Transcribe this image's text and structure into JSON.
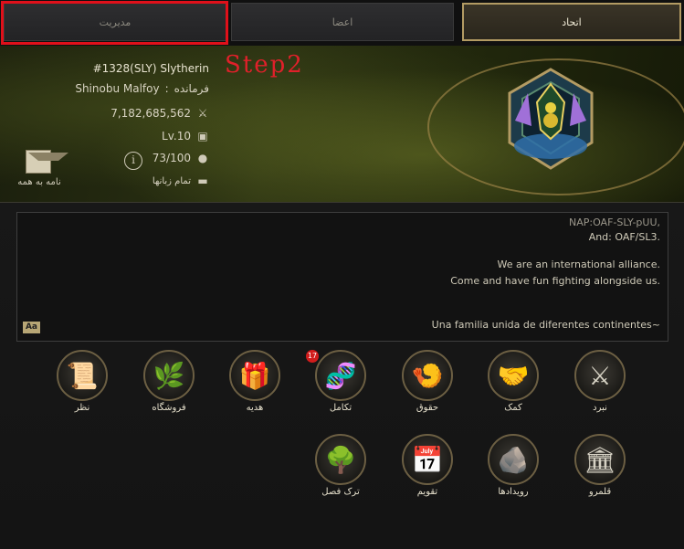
{
  "tabs": [
    {
      "label": "مدیریت"
    },
    {
      "label": "اعضا"
    },
    {
      "label": "اتحاد"
    }
  ],
  "annotation": {
    "step_label": "Step2",
    "highlight_color": "#e0101a"
  },
  "alliance": {
    "rank_name": "#1328(SLY) Slytherin",
    "leader_name": "Shinobu Malfoy",
    "leader_role": "فرمانده",
    "power": "7,182,685,562",
    "level": "Lv.10",
    "members": "73/100",
    "language": "تمام زبانها",
    "mail_label": "نامه به همه"
  },
  "description": {
    "lines": [
      "NAP:OAF-SLY-pUU,",
      "And: OAF/SL3.",
      "We are an international alliance.",
      "Come and have fun fighting alongside us.",
      "Una familia unida de diferentes continentes~"
    ],
    "font_toggle": "Aa"
  },
  "menu": [
    {
      "label": "نظر",
      "icon": "notes-icon"
    },
    {
      "label": "فروشگاه",
      "icon": "shop-icon"
    },
    {
      "label": "هدیه",
      "icon": "gift-icon"
    },
    {
      "label": "تکامل",
      "icon": "dna-icon",
      "badge": "17"
    },
    {
      "label": "حقوق",
      "icon": "salary-icon"
    },
    {
      "label": "کمک",
      "icon": "handshake-icon"
    },
    {
      "label": "نبرد",
      "icon": "crossed-swords-icon"
    },
    {
      "label": "ترک فصل",
      "icon": "leave-season-icon"
    },
    {
      "label": "تقویم",
      "icon": "calendar-icon"
    },
    {
      "label": "رویدادها",
      "icon": "events-icon"
    },
    {
      "label": "قلمرو",
      "icon": "territory-icon"
    }
  ],
  "colors": {
    "accent_gold": "#b39b63",
    "banner_green": "#2b3212",
    "badge_red": "#d21c1c"
  }
}
